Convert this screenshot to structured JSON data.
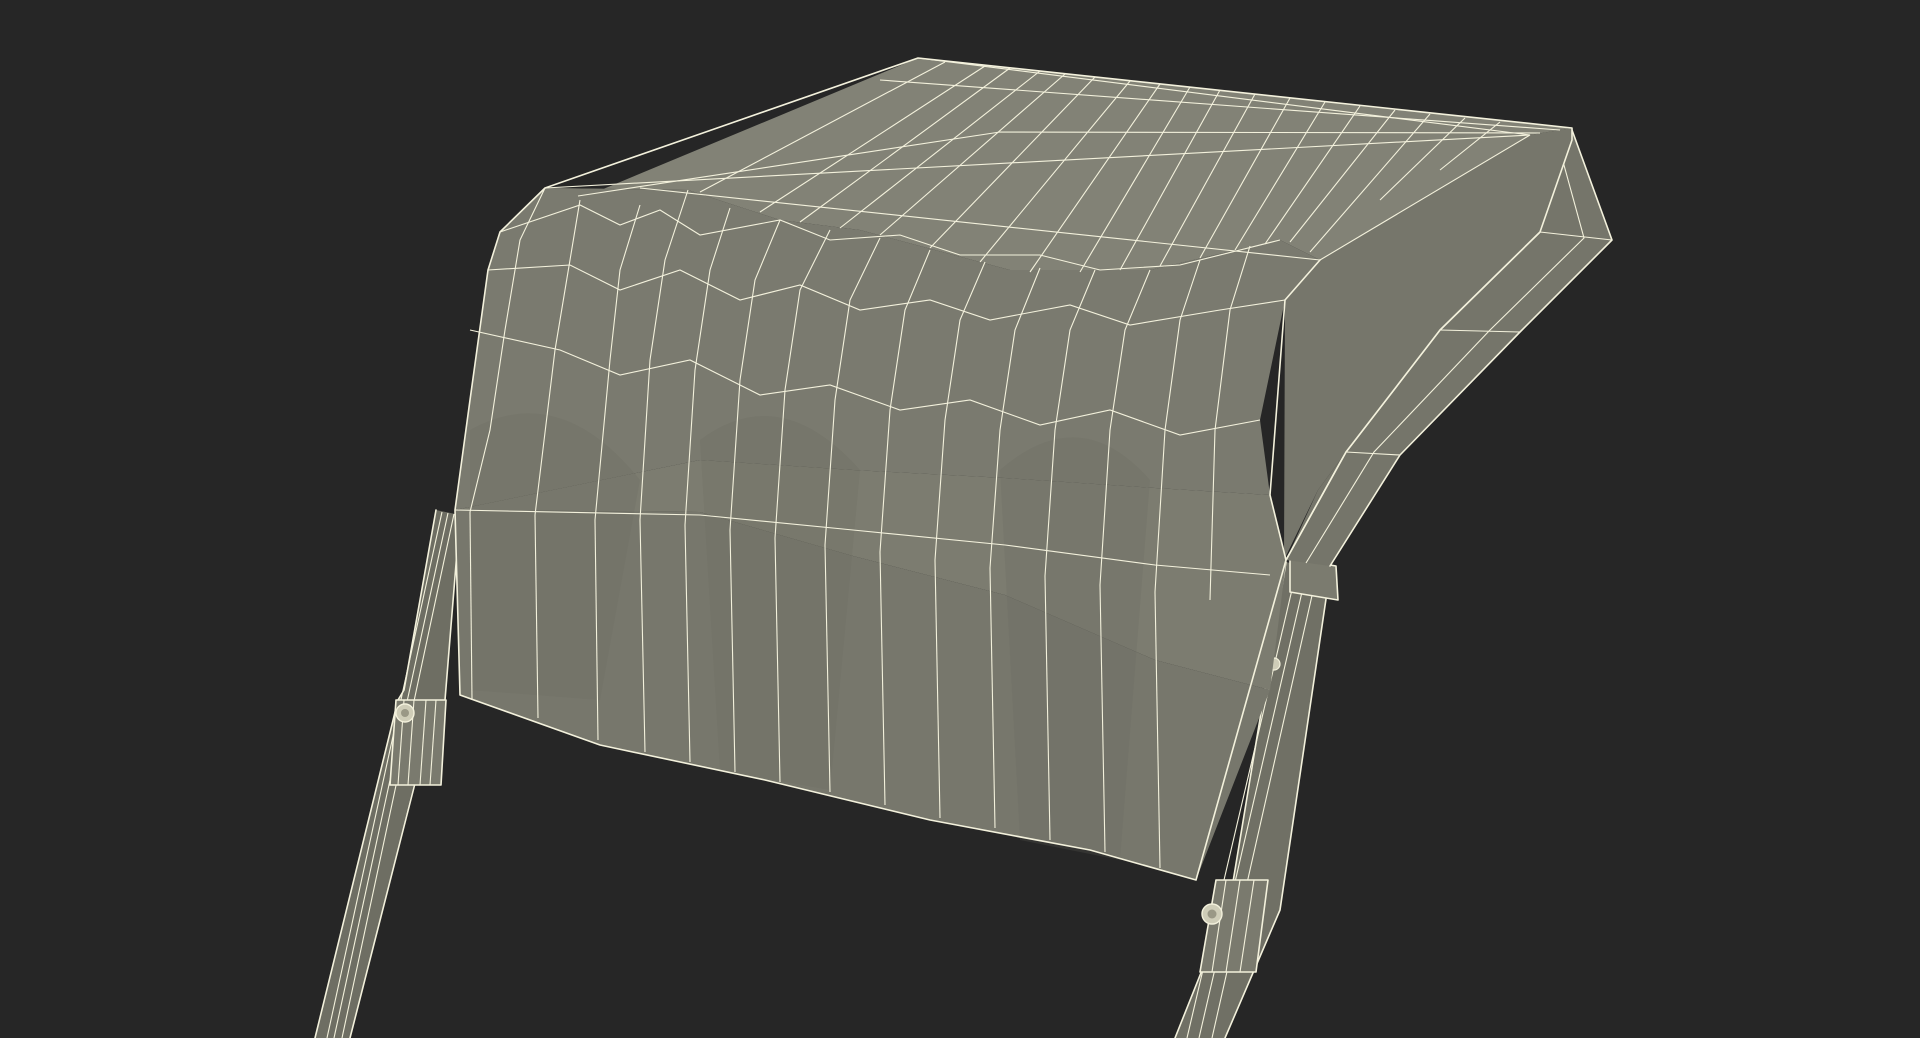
{
  "scene": {
    "subject": "",
    "colors": {
      "background": "#262626",
      "surface": "#7e7e72",
      "surface_dark": "#6c6c61",
      "surface_light": "#8a8a7e",
      "wireframe": "#f3f1dc",
      "bolt": "#cfcdb8"
    }
  }
}
